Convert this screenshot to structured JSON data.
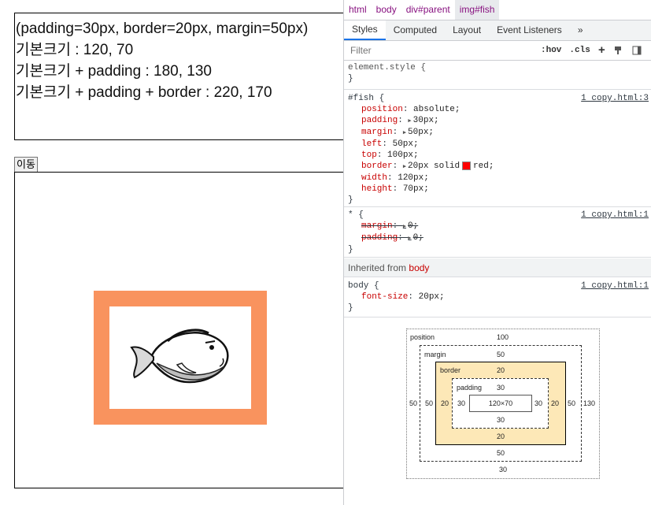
{
  "page": {
    "info_lines": [
      "(padding=30px, border=20px, margin=50px)",
      "기본크기 : 120, 70",
      "기본크기 + padding : 180, 130",
      "기본크기 + padding + border : 220, 170"
    ],
    "move_button": "이동"
  },
  "devtools": {
    "breadcrumbs": [
      "html",
      "body",
      "div#parent",
      "img#fish"
    ],
    "tabs": [
      "Styles",
      "Computed",
      "Layout",
      "Event Listeners",
      "»"
    ],
    "filter_placeholder": "Filter",
    "tools": [
      ":hov",
      ".cls",
      "+"
    ],
    "element_style": {
      "selector": "element.style {",
      "close": "}"
    },
    "fish_rule": {
      "selector": "#fish {",
      "source": "1 copy.html:3",
      "decls": [
        {
          "prop": "position",
          "val": "absolute;"
        },
        {
          "prop": "padding",
          "val": "30px;"
        },
        {
          "prop": "margin",
          "val": "50px;"
        },
        {
          "prop": "left",
          "val": "50px;"
        },
        {
          "prop": "top",
          "val": "100px;"
        },
        {
          "prop": "border",
          "val": "20px solid",
          "val2": "red;"
        },
        {
          "prop": "width",
          "val": "120px;"
        },
        {
          "prop": "height",
          "val": "70px;"
        }
      ],
      "close": "}"
    },
    "star_rule": {
      "selector": "* {",
      "source": "1 copy.html:1",
      "decls": [
        {
          "prop": "margin",
          "val": "0;"
        },
        {
          "prop": "padding",
          "val": "0;"
        }
      ],
      "close": "}"
    },
    "inherited": {
      "label": "Inherited from",
      "tag": "body"
    },
    "body_rule": {
      "selector": "body {",
      "source": "1 copy.html:1",
      "decls": [
        {
          "prop": "font-size",
          "val": "20px;"
        }
      ],
      "close": "}"
    },
    "box_model": {
      "position_label": "position",
      "position_top": "100",
      "position_left": "50",
      "position_right": "130",
      "position_bottom": "30",
      "margin_label": "margin",
      "margin_top": "50",
      "margin_left": "50",
      "margin_right": "50",
      "margin_bottom": "50",
      "border_label": "border",
      "border_top": "20",
      "border_left": "20",
      "border_right": "20",
      "border_bottom": "20",
      "padding_label": "padding",
      "padding_top": "30",
      "padding_left": "30",
      "padding_right": "30",
      "padding_bottom": "30",
      "content": "120×70"
    }
  },
  "colors": {
    "fish_border": "#f9935e",
    "devtools_tab_accent": "#1a73e8",
    "prop_red": "#c80000",
    "box_border_yellow": "#fde8b7"
  }
}
